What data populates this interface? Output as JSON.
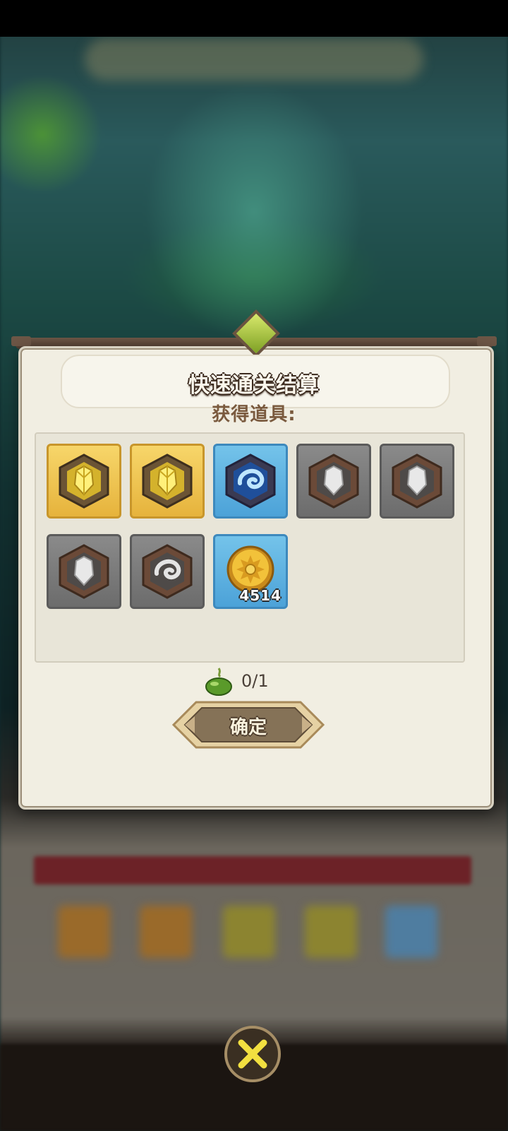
{
  "dialog": {
    "title": "快速通关结算",
    "rewards_label": "获得道具:",
    "items": [
      {
        "icon": "gold-crystal-icon",
        "frame": "gold",
        "count": ""
      },
      {
        "icon": "gold-crystal-icon",
        "frame": "gold",
        "count": ""
      },
      {
        "icon": "blue-swirl-orb-icon",
        "frame": "blue",
        "count": ""
      },
      {
        "icon": "silver-crystal-icon",
        "frame": "gray",
        "count": ""
      },
      {
        "icon": "silver-crystal-icon",
        "frame": "gray",
        "count": ""
      },
      {
        "icon": "silver-crystal-icon",
        "frame": "gray",
        "count": ""
      },
      {
        "icon": "silver-swirl-icon",
        "frame": "gray",
        "count": ""
      },
      {
        "icon": "gold-coin-icon",
        "frame": "blue",
        "count": "4514"
      }
    ],
    "stamina": {
      "icon": "green-potion-icon",
      "text": "0/1"
    },
    "confirm_label": "确定"
  },
  "close": {
    "icon": "close-x-icon"
  },
  "colors": {
    "paper": "#f1eee2",
    "title_outline": "#3b2a1e",
    "label_brown": "#7a5a3e",
    "gold_frame": "#e6b33c",
    "blue_frame": "#4ca2d8",
    "gray_frame": "#6c6c6c",
    "button_brown": "#857257"
  }
}
